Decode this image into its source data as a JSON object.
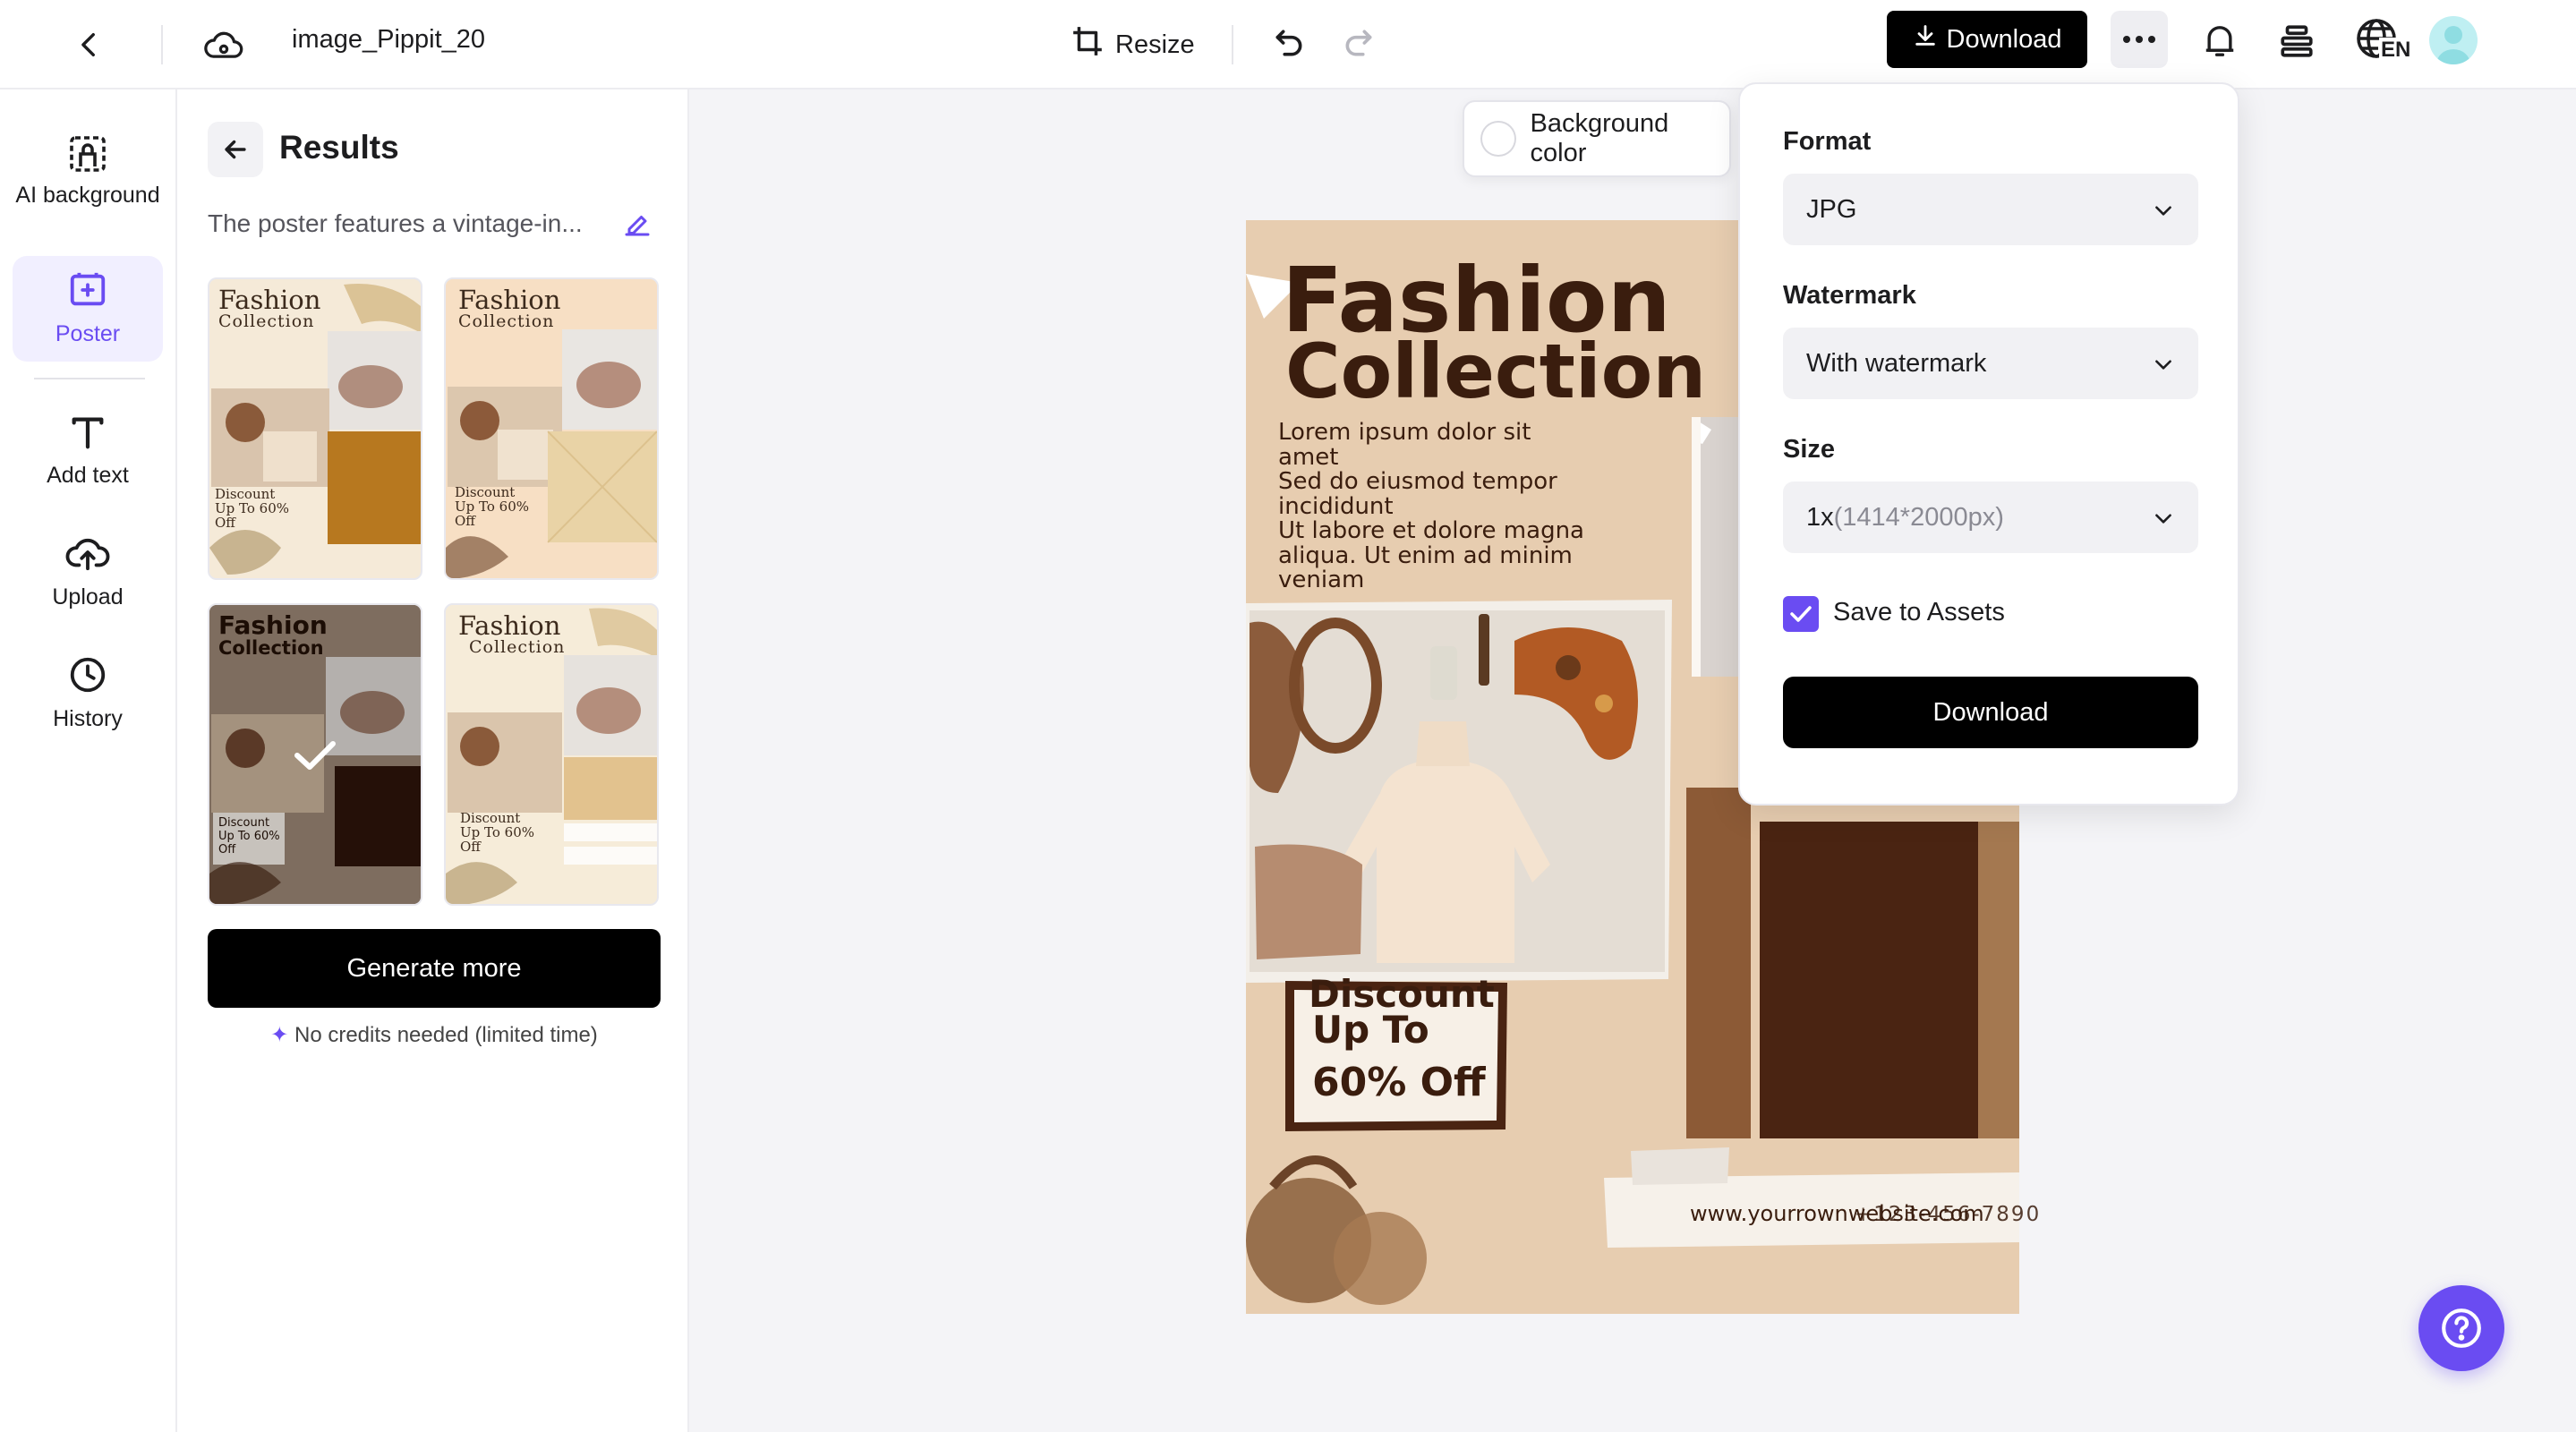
{
  "header": {
    "doc_title": "image_Pippit_20",
    "resize_label": "Resize",
    "download_label": "Download",
    "language_badge": "EN",
    "icons": [
      "back-arrow-icon",
      "cloud-sync-icon",
      "resize-icon",
      "undo-icon",
      "redo-icon",
      "download-arrow-icon",
      "more-dots-icon",
      "bell-icon",
      "layers-icon",
      "globe-language-icon",
      "avatar"
    ]
  },
  "rail": {
    "items": [
      {
        "label": "AI background",
        "icon": "ai-background-icon"
      },
      {
        "label": "Poster",
        "icon": "poster-icon",
        "active": true
      },
      {
        "label": "Add text",
        "icon": "text-icon"
      },
      {
        "label": "Upload",
        "icon": "upload-cloud-icon"
      },
      {
        "label": "History",
        "icon": "clock-icon"
      }
    ]
  },
  "results": {
    "title": "Results",
    "prompt": "The poster features a vintage-in...",
    "thumbnails": [
      {
        "title_line1": "Fashion",
        "title_line2": "Collection",
        "discount": "Discount Up To 60% Off",
        "selected": false
      },
      {
        "title_line1": "Fashion",
        "title_line2": "Collection",
        "discount": "Discount Up To 60% Off",
        "selected": false
      },
      {
        "title_line1": "Fashion",
        "title_line2": "Collection",
        "discount": "Discount Up To 60% Off",
        "selected": true
      },
      {
        "title_line1": "Fashion",
        "title_line2": "Collection",
        "discount": "Discount Up To 60% Off",
        "selected": false
      }
    ],
    "generate_label": "Generate more",
    "credits_note": "No credits needed (limited time)"
  },
  "canvas": {
    "background_color_label": "Background color",
    "poster": {
      "title_line1": "Fashion",
      "title_line2": "Collection",
      "body_lines": [
        "Lorem ipsum dolor sit",
        "amet",
        "Sed do eiusmod tempor",
        "incididunt",
        "Ut labore et dolore magna",
        "aliqua. Ut enim ad minim",
        "veniam"
      ],
      "discount_line1": "Discount",
      "discount_line2": "Up To",
      "discount_line3": "60% Off",
      "website": "www.yourrownwebsite.com",
      "phone": "+123-456-7890"
    }
  },
  "download_menu": {
    "format_label": "Format",
    "format_value": "JPG",
    "watermark_label": "Watermark",
    "watermark_value": "With watermark",
    "size_label": "Size",
    "size_value_main": "1x",
    "size_value_detail": "(1414*2000px)",
    "save_assets_label": "Save to Assets",
    "save_assets_checked": true,
    "download_label": "Download"
  },
  "colors": {
    "accent": "#6a4cf2",
    "primary_button": "#000000",
    "poster_bg": "#e7cdb0",
    "poster_brown": "#4a2412"
  }
}
